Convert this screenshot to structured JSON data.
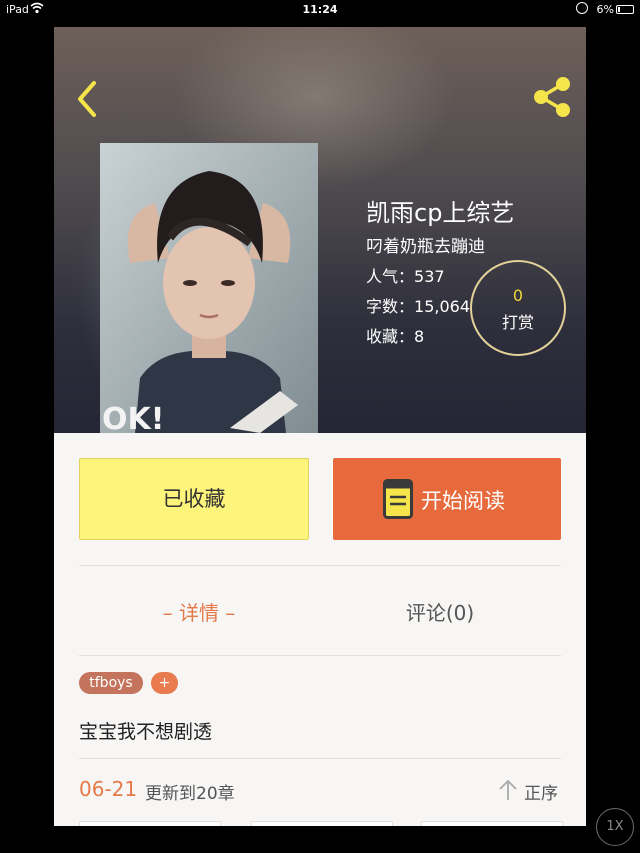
{
  "status_bar": {
    "device": "iPad",
    "time": "11:24",
    "battery": "6%"
  },
  "book": {
    "title": "凯雨cp上综艺",
    "author": "叼着奶瓶去蹦迪",
    "popularity_label": "人气：",
    "popularity": "537",
    "word_count_label": "字数：",
    "word_count": "15,064",
    "favorites_label": "收藏：",
    "favorites": "8"
  },
  "tip": {
    "count": "0",
    "label": "打赏"
  },
  "actions": {
    "favorited_label": "已收藏",
    "read_label": "开始阅读"
  },
  "tabs": {
    "detail": "– 详情 –",
    "comments": "评论(0)"
  },
  "tags": [
    "tfboys"
  ],
  "add_tag": "+",
  "description": "宝宝我不想剧透",
  "update": {
    "date": "06-21",
    "text": "更新到20章",
    "sort_label": "正序"
  },
  "zoom": "1X",
  "colors": {
    "accent": "#e76a3c",
    "favorite_button": "#fdf47b",
    "tab_active": "#e47a4a",
    "tip_count": "#f0d63a",
    "icon_yellow": "#f5e54b"
  }
}
